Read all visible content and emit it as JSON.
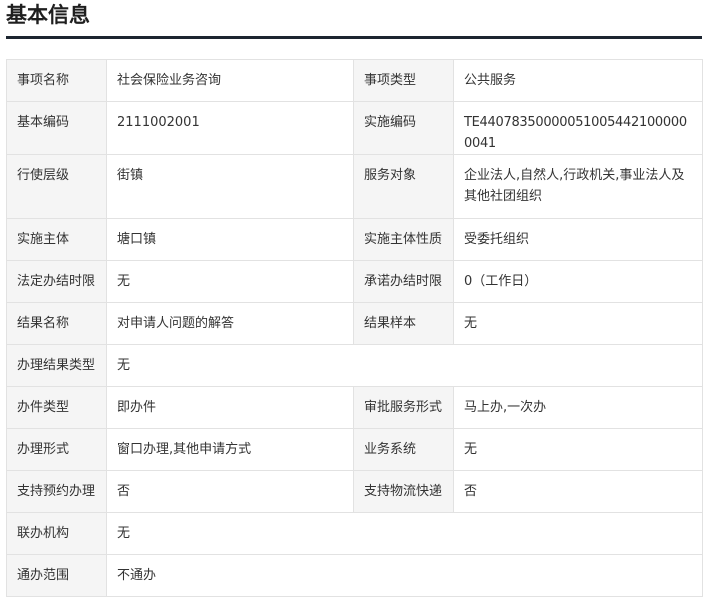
{
  "page": {
    "title": "基本信息"
  },
  "rows": [
    {
      "l1": "事项名称",
      "v1": "社会保险业务咨询",
      "l2": "事项类型",
      "v2": "公共服务"
    },
    {
      "l1": "基本编码",
      "v1": "2111002001",
      "l2": "实施编码",
      "v2": "TE440783500000510054421000000041"
    },
    {
      "l1": "行使层级",
      "v1": "街镇",
      "l2": "服务对象",
      "v2": "企业法人,自然人,行政机关,事业法人及其他社团组织"
    },
    {
      "l1": "实施主体",
      "v1": "塘口镇",
      "l2": "实施主体性质",
      "v2": "受委托组织"
    },
    {
      "l1": "法定办结时限",
      "v1": "无",
      "l2": "承诺办结时限",
      "v2": "0（工作日）"
    },
    {
      "l1": "结果名称",
      "v1": "对申请人问题的解答",
      "l2": "结果样本",
      "v2": "无"
    },
    {
      "l1": "办理结果类型",
      "v1": "无"
    },
    {
      "l1": "办件类型",
      "v1": "即办件",
      "l2": "审批服务形式",
      "v2": "马上办,一次办"
    },
    {
      "l1": "办理形式",
      "v1": "窗口办理,其他申请方式",
      "l2": "业务系统",
      "v2": "无"
    },
    {
      "l1": "支持预约办理",
      "v1": "否",
      "l2": "支持物流快递",
      "v2": "否"
    },
    {
      "l1": "联办机构",
      "v1": "无"
    },
    {
      "l1": "通办范围",
      "v1": "不通办"
    }
  ]
}
